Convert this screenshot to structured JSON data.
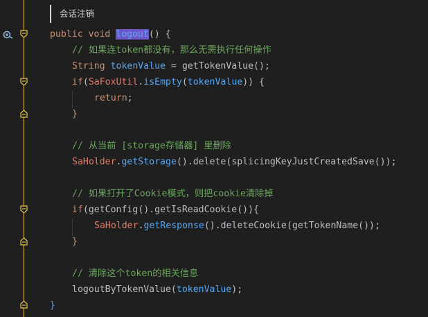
{
  "editor": {
    "hint": "会话注销",
    "lines": {
      "l1": {
        "kw": "public void ",
        "fn": "logout",
        "rest": "() {"
      },
      "l2": {
        "comment": "// 如果连token都没有，那么无需执行任何操作"
      },
      "l3": {
        "type": "String ",
        "var": "tokenValue",
        "op": " = ",
        "call": "getTokenValue",
        "paren": "();"
      },
      "l4": {
        "kw": "if",
        "p1": "(",
        "cls": "SaFoxUtil",
        "dot": ".",
        "call": "isEmpty",
        "p2": "(",
        "var": "tokenValue",
        "p3": ")) {"
      },
      "l5": {
        "kw": "return",
        "rest": ";"
      },
      "l6": {
        "rest": "}"
      },
      "l7": {
        "comment": "// 从当前 [storage存储器] 里删除"
      },
      "l8": {
        "cls": "SaHolder",
        "dot": ".",
        "call": "getStorage",
        "p1": "().",
        "m": "delete",
        "p2": "(",
        "arg": "splicingKeyJustCreatedSave",
        "p3": "());"
      },
      "l9": {
        "comment": "// 如果打开了Cookie模式，则把cookie清除掉"
      },
      "l10": {
        "kw": "if",
        "p1": "(",
        "call": "getConfig",
        "p2": "().",
        "m": "getIsReadCookie",
        "p3": "()){"
      },
      "l11": {
        "cls": "SaHolder",
        "dot": ".",
        "call": "getResponse",
        "p1": "().",
        "m": "deleteCookie",
        "p2": "(",
        "arg": "getTokenName",
        "p3": "());"
      },
      "l12": {
        "rest": "}"
      },
      "l13": {
        "comment": "// 清除这个token的相关信息"
      },
      "l14": {
        "call": "logoutByTokenValue",
        "p1": "(",
        "var": "tokenValue",
        "p2": ");"
      },
      "l15": {
        "rest": "}"
      }
    }
  },
  "icons": {
    "debug": "method-breakpoint-icon",
    "fold": "fold-marker-icon"
  },
  "colors": {
    "background": "#1f1f1f",
    "keyword": "#cf8e6d",
    "method": "#56a8f5",
    "class": "#e67a63",
    "comment": "#6aa85a",
    "selection": "#6f56c8",
    "fold_marker": "#e7c547"
  }
}
